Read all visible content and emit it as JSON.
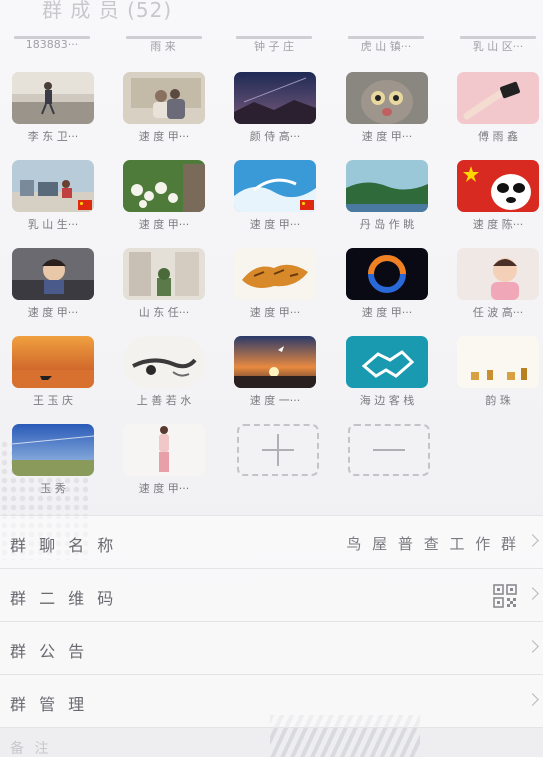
{
  "header": {
    "title": "群 成 员 (52)"
  },
  "top_row_names": [
    "183883···",
    "雨 来",
    "钟 子 庄",
    "虎 山 镇···",
    "乳 山 区···"
  ],
  "members": [
    {
      "name": "李 东 卫···"
    },
    {
      "name": "速 度 甲···"
    },
    {
      "name": "颜 侍 高···"
    },
    {
      "name": "速 度 甲···"
    },
    {
      "name": "傅 雨 鑫"
    },
    {
      "name": "乳 山 生···"
    },
    {
      "name": "速 度 甲···"
    },
    {
      "name": "速 度 甲···"
    },
    {
      "name": "丹 岛 作 眺"
    },
    {
      "name": "速 度 陈···"
    },
    {
      "name": "速 度 甲···"
    },
    {
      "name": "山 东 任···"
    },
    {
      "name": "速 度 甲···"
    },
    {
      "name": "速 度 甲···"
    },
    {
      "name": "任 波 高···"
    },
    {
      "name": "王 玉 庆"
    },
    {
      "name": "上 善 若 水"
    },
    {
      "name": "速 度 一···"
    },
    {
      "name": "海 边 客 栈"
    },
    {
      "name": "韵 珠"
    },
    {
      "name": "玉 秀"
    },
    {
      "name": "速 度 甲···"
    }
  ],
  "settings": {
    "group_name_label": "群 聊 名 称",
    "group_name_value": "鸟 屋 普 查 工 作 群",
    "qr_label": "群 二 维 码",
    "notice_label": "群 公 告",
    "manage_label": "群 管 理"
  },
  "bottom_hint": "备 注"
}
